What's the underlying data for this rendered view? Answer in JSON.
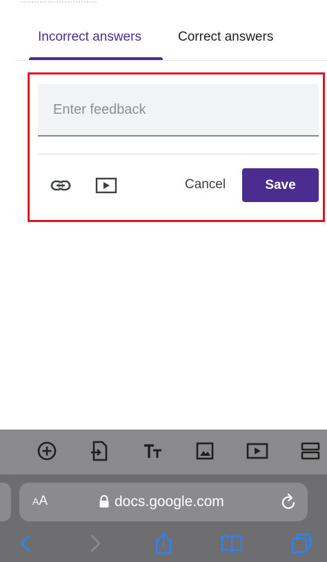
{
  "tabs": {
    "incorrect_label": "Incorrect answers",
    "correct_label": "Correct answers",
    "active": "incorrect"
  },
  "feedback": {
    "placeholder": "Enter feedback",
    "value": ""
  },
  "actions": {
    "cancel_label": "Cancel",
    "save_label": "Save"
  },
  "icons": {
    "link": "link-icon",
    "video": "video-icon",
    "toolbar": [
      "add-circle-icon",
      "import-question-icon",
      "title-icon",
      "image-icon",
      "video-icon",
      "section-icon"
    ],
    "browser_nav": [
      "back-icon",
      "forward-icon",
      "share-icon",
      "bookmarks-icon",
      "tabs-icon"
    ]
  },
  "browser": {
    "aa_small": "A",
    "aa_large": "A",
    "url": "docs.google.com"
  },
  "colors": {
    "accent": "#4a2d8f",
    "highlight": "#e0141b",
    "ios_blue": "#2b83f6"
  }
}
